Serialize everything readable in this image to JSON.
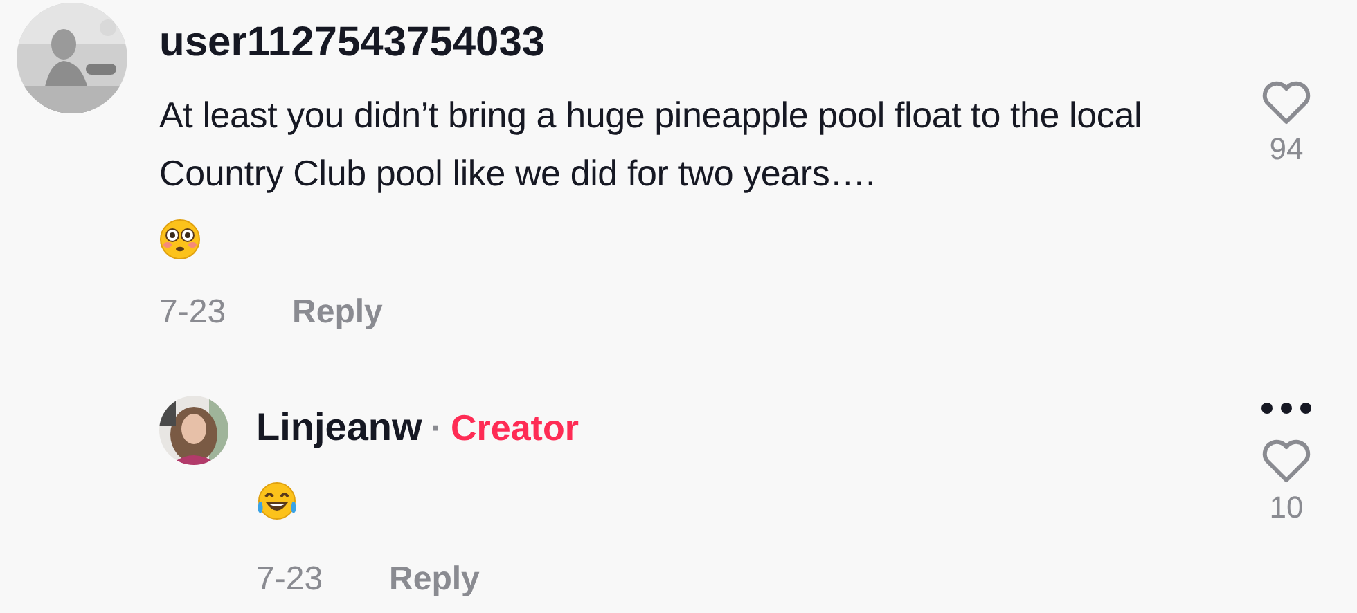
{
  "comments": [
    {
      "username": "user1127543754033",
      "text": "At least you didn’t bring a huge pineapple pool float to the local Country Club pool like we did for two years….",
      "emoji": {
        "kind": "flushed"
      },
      "date": "7-23",
      "reply_label": "Reply",
      "likes": "94",
      "show_more_menu": false,
      "replies": [
        {
          "username": "Linjeanw",
          "separator": "·",
          "badge": "Creator",
          "emoji": {
            "kind": "laughing"
          },
          "date": "7-23",
          "reply_label": "Reply",
          "likes": "10",
          "show_more_menu": true
        }
      ]
    }
  ]
}
